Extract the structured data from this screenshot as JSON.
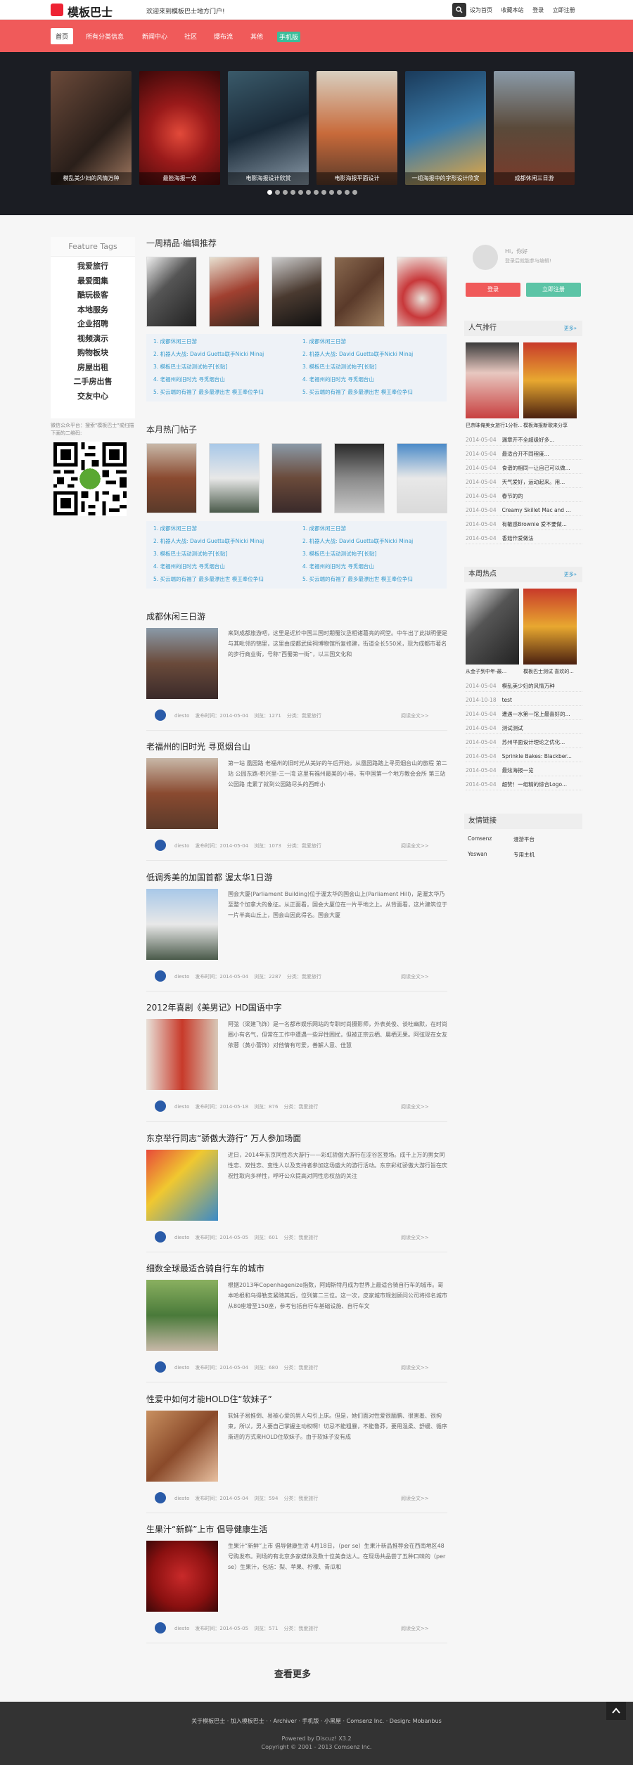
{
  "header": {
    "site_name": "模板巴士",
    "welcome": "欢迎来到模板巴士地方门户!",
    "links": [
      "设为首页",
      "收藏本站",
      "登录",
      "立即注册"
    ]
  },
  "nav": [
    "首页",
    "所有分类信息",
    "新闻中心",
    "社区",
    "爆布流",
    "其他",
    "手机版"
  ],
  "banner": {
    "slides": [
      "模乱美少妇的风情万种",
      "最脸海报一览",
      "电影海报设计欣赏",
      "电影海报平面设计",
      "一组海报中的字形设计欣赏",
      "成都休闲三日游"
    ],
    "dot_count": 12
  },
  "tags": {
    "title": "Feature Tags",
    "items": [
      "我爱旅行",
      "最爱图集",
      "酷玩极客",
      "本地服务",
      "企业招聘",
      "视频演示",
      "购物板块",
      "房屋出租",
      "二手房出售",
      "交友中心"
    ]
  },
  "wx_note": "微信公众平台：搜索\"模板巴士\"或扫描下面的二维码:",
  "picks": {
    "title": "一周精品·编辑推荐",
    "links_left": [
      "1. 成都休闲三日游",
      "2. 机器人大战: David Guetta联手Nicki Minaj",
      "3. 模板巴士活动测试帖子[长贴]",
      "4. 老福州的旧时光 寻觅烟台山",
      "5. 买云端的有福了 最多最漂出世 模王奉位争归"
    ],
    "links_right": [
      "1. 成都休闲三日游",
      "2. 机器人大战: David Guetta联手Nicki Minaj",
      "3. 模板巴士活动测试帖子[长贴]",
      "4. 老福州的旧时光 寻觅烟台山",
      "5. 买云端的有福了 最多最漂出世 模王奉位争归"
    ]
  },
  "hot": {
    "title": "本月热门帖子",
    "links_left": [
      "1. 成都休闲三日游",
      "2. 机器人大战: David Guetta联手Nicki Minaj",
      "3. 模板巴士活动测试帖子[长贴]",
      "4. 老福州的旧时光 寻觅烟台山",
      "5. 买云端的有福了 最多最漂出世 模王奉位争归"
    ],
    "links_right": [
      "1. 成都休闲三日游",
      "2. 机器人大战: David Guetta联手Nicki Minaj",
      "3. 模板巴士活动测试帖子[长贴]",
      "4. 老福州的旧时光 寻觅烟台山",
      "5. 买云端的有福了 最多最漂出世 模王奉位争归"
    ]
  },
  "articles": [
    {
      "title": "成都休闲三日游",
      "text": "来到成都旅游吧，这里是近於中国三国时期蜀汉丞相诸葛亮的祠堂。中午出了此拟明便是与其毗邻的锦里，这里由成都武侯祠博物馆所复修建，街道全长550米，现为成都市著名的步行商业街，号称“西蜀第一街”，以三国文化和",
      "date": "发布时间：2014-05-04",
      "views": "浏览：1271",
      "cat": "分类：我爱旅行"
    },
    {
      "title": "老福州的旧时光 寻觅烟台山",
      "text": "第一站 凰园路 老福州的旧时光从美好的午后开始，从凰园路踏上寻觅烟台山的旅程 第二站 公园东路-积兴里-三一湾 这里有福州最美的小巷，有中国第一个地方教会会所 第三站 公园路 走累了就到公园路尽头的西畔小",
      "date": "发布时间：2014-05-04",
      "views": "浏览：1073",
      "cat": "分类：我爱旅行"
    },
    {
      "title": "低调秀美的加国首都 渥太华1日游",
      "text": "国会大厦(Parliament Building)位于渥太华的国会山上(Parliament Hill)，是渥太华乃至整个加拿大的象征。从正面看，国会大厦位在一片平地之上。从背面看，这片建筑位于一片半高山丘上，国会山因此得名。国会大厦",
      "date": "发布时间：2014-05-04",
      "views": "浏览：2287",
      "cat": "分类：我爱旅行"
    },
    {
      "title": "2012年喜剧《美男记》HD国语中字",
      "text": "阿弦（梁建飞饰）是一名都市娱乐网站的专职时尚摄影师，外表英俊、谈吐幽默，在时尚圈小有名气，但常在工作中遭遇一些异性困扰，但被正宗云栖、晨栖无果。阿弦现在女友依蓉（黄小蕾饰）对他情有可爱，善解人意、佳慧",
      "date": "发布时间：2014-05-18",
      "views": "浏览：876",
      "cat": "分类：我爱旅行"
    },
    {
      "title": "东京举行同志“骄傲大游行” 万人参加场面",
      "text": "近日，2014年东京同性恋大游行——彩虹骄傲大游行在涩谷区登场。成千上万的男女同性恋、双性恋、变性人以及支持者参加这场盛大的游行活动。东京彩虹骄傲大游行旨在庆祝性取向多样性，呼吁公众提高对同性恋权益的关注",
      "date": "发布时间：2014-05-05",
      "views": "浏览：601",
      "cat": "分类：我爱旅行"
    },
    {
      "title": "细数全球最适合骑自行车的城市",
      "text": "根据2013年Copenhagenize指数，阿姆斯特丹成为世界上最适合骑自行车的城市。哥本哈根和乌得勒支紧随其后，位列第二三位。这一次，皮家城市规划顾问公司将排名城市从80座增至150座，参考包括自行车基础设施、自行车文",
      "date": "发布时间：2014-05-04",
      "views": "浏览：680",
      "cat": "分类：我爱旅行"
    },
    {
      "title": "性爱中如何才能HOLD住“软妹子”",
      "text": "软妹子易推倒、易被心爱的男人勾引上床。但是，她们面对性爱很腼腆、很害羞、很拘束，所以，男人要自己掌握主动权啊！切忌不能粗暴，不能鲁莽，要用温柔、舒缓、循序渐进的方式来HOLD住软妹子。由于软妹子没有成",
      "date": "发布时间：2014-05-04",
      "views": "浏览：594",
      "cat": "分类：我爱旅行"
    },
    {
      "title": "生果汁“新鲜”上市 倡导健康生活",
      "text": "生果汁“新鲜”上市 倡导健康生活 4月18日，（per se）生果汁新品推荐会在西南地区48号购发布。到场的有北京多家媒体及数十位美食达人。在现场共品尝了五种口味的（per se）生果汁，包括：梨、苹果、柠檬、青瓜和",
      "date": "发布时间：2014-05-05",
      "views": "浏览：571",
      "cat": "分类：我爱旅行"
    }
  ],
  "author": "diesto",
  "read_more": "阅读全文>>",
  "load_more": "查看更多",
  "login": {
    "hi": "Hi，你好",
    "tip": "登录后就能参与编辑!",
    "login_btn": "登录",
    "register_btn": "立即注册"
  },
  "popular": {
    "title": "人气排行",
    "more": "更多»",
    "img_caption": "巴奈昧俺美女旅行1分析...",
    "img_caption2": "模板海报新歌来分享",
    "rows": [
      [
        "2014-05-04",
        "漏章开不全超级好多..."
      ],
      [
        "2014-05-04",
        "最适合开不同程度..."
      ],
      [
        "2014-05-04",
        "食谱的相同一让自己可以做..."
      ],
      [
        "2014-05-04",
        "天气爱好，运动起来。用..."
      ],
      [
        "2014-05-04",
        "春节的的"
      ],
      [
        "2014-05-04",
        "Creamy Skillet Mac and ..."
      ],
      [
        "2014-05-04",
        "有敏感Brownie 爱不要做..."
      ],
      [
        "2014-05-04",
        "香菇作爱做法"
      ]
    ]
  },
  "weekly": {
    "title": "本周热点",
    "more": "更多»",
    "img_caption": "从金子到中年-最...",
    "img_caption2": "模板巴士测试 喜欢的...",
    "rows": [
      [
        "2014-05-04",
        "模乱美少妇的风情万种"
      ],
      [
        "2014-10-18",
        "test"
      ],
      [
        "2014-05-04",
        "遭遇一水第一馆上最喜好的..."
      ],
      [
        "2014-05-04",
        "测试测试"
      ],
      [
        "2014-05-04",
        "苏州平面设计理论之优化..."
      ],
      [
        "2014-05-04",
        "Sprinkle Bakes: Blackber..."
      ],
      [
        "2014-05-04",
        "最炫海报一览"
      ],
      [
        "2014-05-04",
        "超赞！一组精的综合Logo..."
      ]
    ]
  },
  "friends": {
    "title": "友情链接",
    "items": [
      "Comsenz",
      "漫游平台",
      "Yeswan",
      "专用主机"
    ]
  },
  "footer": {
    "line1": "关于模板巴士 · 加入模板巴士 ·    · Archiver · 手机版 · 小黑屋 · Comsenz Inc.  ·  Design: Mobanbus",
    "powered": "Powered by Discuz! X3.2",
    "copyright": "Copyright © 2001 - 2013 Comsenz Inc."
  },
  "colors": {
    "brand": "#f05a5a",
    "accent": "#5cc4a6",
    "link": "#3399cc"
  }
}
